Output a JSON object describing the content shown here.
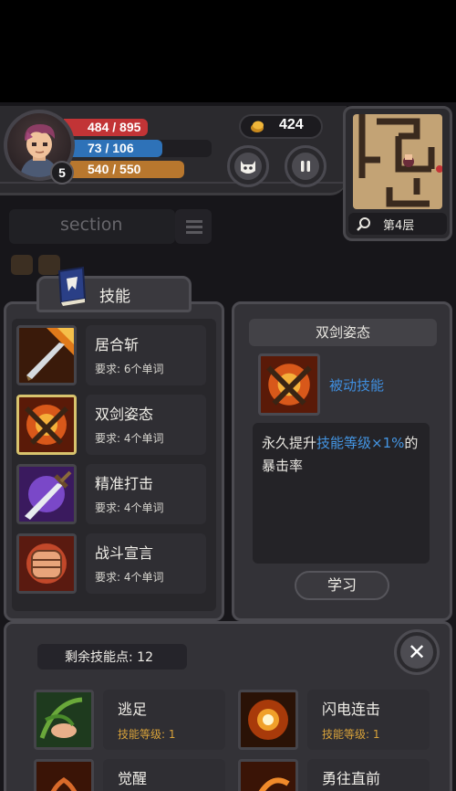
{
  "hud": {
    "hp": "484 / 895",
    "hp_fraction": 0.54,
    "mp": "73 / 106",
    "mp_fraction": 0.69,
    "xp": "540 / 550",
    "xp_fraction": 0.98,
    "level": "5",
    "gold": "424",
    "floor": "第4层",
    "icons": [
      "coin-icon",
      "monster-face-icon",
      "pause-icon",
      "magnifier-icon"
    ]
  },
  "section_label": "section",
  "skills_tab": {
    "label": "技能",
    "icon": "skill-book-icon"
  },
  "skills": [
    {
      "name": "居合斩",
      "req": "要求: 6个单词",
      "icon": "sword-slash-icon",
      "selected": false
    },
    {
      "name": "双剑姿态",
      "req": "要求: 4个单词",
      "icon": "crossed-swords-icon",
      "selected": true
    },
    {
      "name": "精准打击",
      "req": "要求: 4个单词",
      "icon": "greatsword-icon",
      "selected": false
    },
    {
      "name": "战斗宣言",
      "req": "要求: 4个单词",
      "icon": "fist-icon",
      "selected": false
    }
  ],
  "detail": {
    "title": "双剑姿态",
    "type": "被动技能",
    "desc_prefix": "永久提升",
    "desc_highlight": "技能等级×1%",
    "desc_suffix": "的暴击率",
    "learn_button": "学习"
  },
  "points": {
    "label": "剩余技能点: 12"
  },
  "learned_skills": [
    {
      "name": "逃足",
      "level": "技能等级: 1",
      "icon": "vine-foot-icon"
    },
    {
      "name": "闪电连击",
      "level": "技能等级: 1",
      "icon": "flash-burst-icon"
    },
    {
      "name": "觉醒",
      "level": "",
      "icon": "awaken-icon"
    },
    {
      "name": "勇往直前",
      "level": "",
      "icon": "charge-icon"
    }
  ],
  "colors": {
    "hp": "#c23436",
    "mp": "#2e72b8",
    "xp": "#b8772e",
    "highlight": "#4496e4",
    "skill_level": "#d8a23a"
  }
}
